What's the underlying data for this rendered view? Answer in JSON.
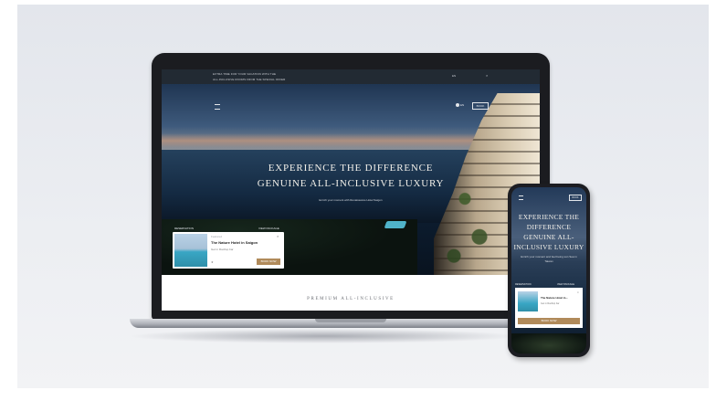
{
  "laptop": {
    "announcement": {
      "line1": "EXTRA TIME FOR YOUR VACATION WITH THE",
      "line2": "ALL-INCLUSIVE ROOMS FROM THE SPECIAL OFFER",
      "right": "EN",
      "close": "×"
    },
    "nav": {
      "lang": "EN",
      "book": "BOOK"
    },
    "hero": {
      "title_line1": "EXPERIENCE THE DIFFERENCE",
      "title_line2": "GENUINE ALL-INCLUSIVE LUXURY",
      "subtitle": "Enrich your moment with Renaissance Hotel Saigon"
    },
    "reservation": {
      "label": "RESERVATION",
      "link": "VIEW PACKAGE",
      "card": {
        "tag": "Featured",
        "title": "The Nature Hotel in Saigon",
        "meta": "Get in Rooftop bar",
        "meta2": "★",
        "button": "BOOK NOW",
        "close": "×"
      }
    },
    "section_heading": "PREMIUM ALL-INCLUSIVE"
  },
  "phone": {
    "book": "BOOK",
    "title_line1": "EXPERIENCE THE",
    "title_line2": "DIFFERENCE",
    "title_line3": "GENUINE ALL-",
    "title_line4": "INCLUSIVE LUXURY",
    "subtitle": "Enrich your moment and feel being sun Sea in Taiwan",
    "reservation_label": "RESERVATION",
    "reservation_link": "VIEW PACKAGE",
    "card": {
      "title": "The Nature Hotel in...",
      "meta": "Get in Rooftop bar",
      "button": "BOOK NOW",
      "close": "×"
    }
  }
}
